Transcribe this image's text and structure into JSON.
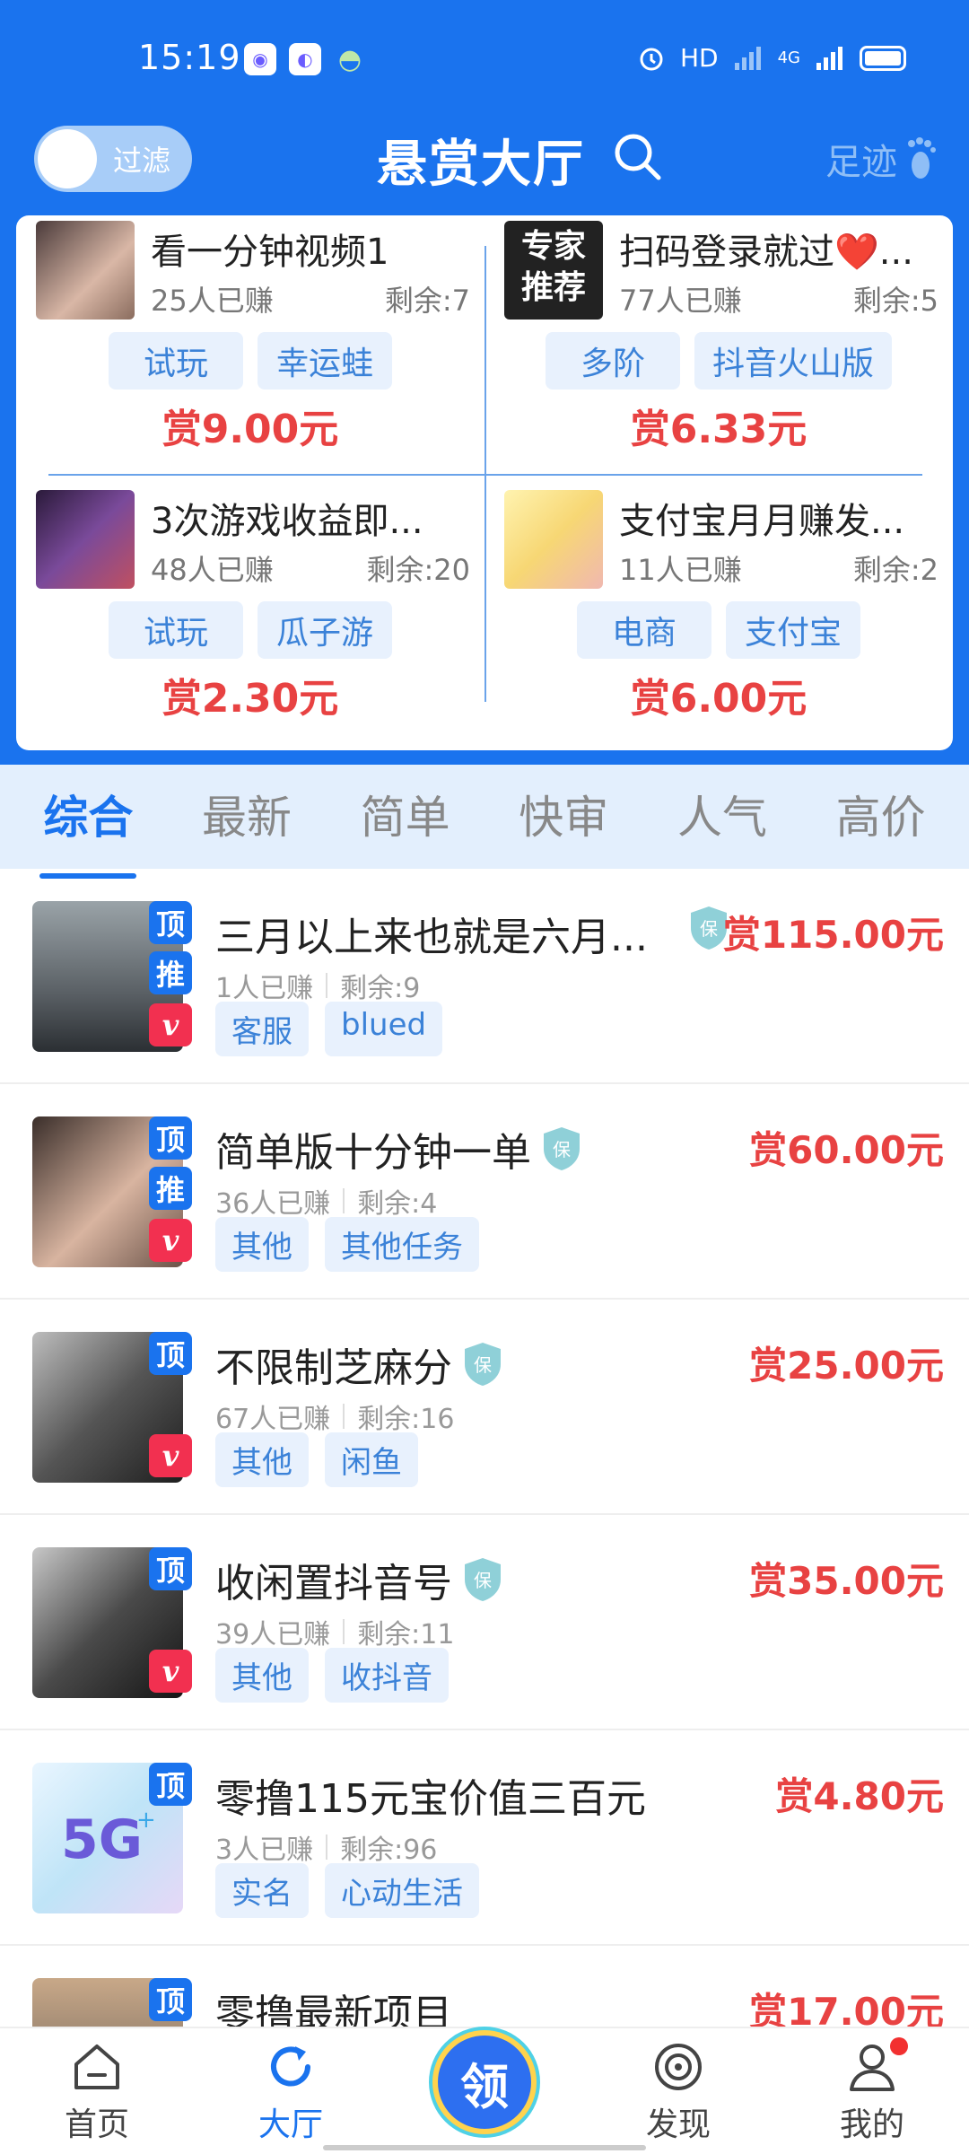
{
  "status_bar": {
    "time": "15:19",
    "network": "HD",
    "signal_label": "4G"
  },
  "header": {
    "filter_label": "过滤",
    "title": "悬赏大厅",
    "footprint_label": "足迹"
  },
  "recommend": [
    {
      "title": "看一分钟视频1",
      "earned": "25人已赚",
      "remaining": "剩余:7",
      "tags": [
        "试玩",
        "幸运蛙"
      ],
      "reward": "赏9.00元",
      "thumb_badge": ""
    },
    {
      "title": "扫码登录就过❤️...",
      "earned": "77人已赚",
      "remaining": "剩余:5",
      "tags": [
        "多阶",
        "抖音火山版"
      ],
      "reward": "赏6.33元",
      "thumb_badge": "专家推荐"
    },
    {
      "title": "3次游戏收益即...",
      "earned": "48人已赚",
      "remaining": "剩余:20",
      "tags": [
        "试玩",
        "瓜子游"
      ],
      "reward": "赏2.30元",
      "thumb_badge": ""
    },
    {
      "title": "支付宝月月赚发...",
      "earned": "11人已赚",
      "remaining": "剩余:2",
      "tags": [
        "电商",
        "支付宝"
      ],
      "reward": "赏6.00元",
      "thumb_badge": ""
    }
  ],
  "tabs": [
    "综合",
    "最新",
    "简单",
    "快审",
    "人气",
    "高价"
  ],
  "badges": {
    "top": "顶",
    "recommend": "推",
    "vip": "v",
    "guarantee": "保"
  },
  "tasks": [
    {
      "title": "三月以上来也就是六月...",
      "earned": "1人已赚",
      "remaining": "剩余:9",
      "tags": [
        "客服",
        "blued"
      ],
      "reward": "赏115.00元"
    },
    {
      "title": "简单版十分钟一单",
      "earned": "36人已赚",
      "remaining": "剩余:4",
      "tags": [
        "其他",
        "其他任务"
      ],
      "reward": "赏60.00元"
    },
    {
      "title": "不限制芝麻分",
      "earned": "67人已赚",
      "remaining": "剩余:16",
      "tags": [
        "其他",
        "闲鱼"
      ],
      "reward": "赏25.00元"
    },
    {
      "title": "收闲置抖音号",
      "earned": "39人已赚",
      "remaining": "剩余:11",
      "tags": [
        "其他",
        "收抖音"
      ],
      "reward": "赏35.00元"
    },
    {
      "title": "零撸115元宝价值三百元",
      "earned": "3人已赚",
      "remaining": "剩余:96",
      "tags": [
        "实名",
        "心动生活"
      ],
      "reward": "赏4.80元"
    },
    {
      "title": "零撸最新项目",
      "earned": "",
      "remaining": "",
      "tags": [],
      "reward": "赏17.00元"
    }
  ],
  "bottom_nav": {
    "home": "首页",
    "hall": "大厅",
    "claim": "领",
    "discover": "发现",
    "mine": "我的"
  },
  "colors": {
    "primary": "#1a73ee",
    "reward": "#e84242",
    "tag_bg": "#e8f1fd"
  }
}
